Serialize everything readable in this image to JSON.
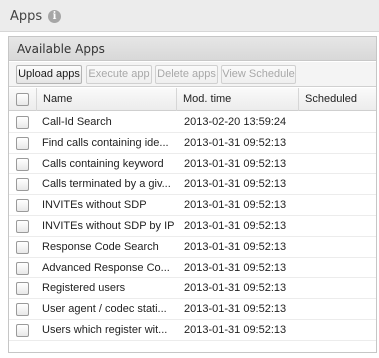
{
  "header": {
    "title": "Apps",
    "info_icon": "i"
  },
  "panel": {
    "title": "Available Apps"
  },
  "toolbar": {
    "upload": "Upload apps",
    "execute": "Execute app",
    "delete": "Delete apps",
    "schedule": "View Schedule"
  },
  "columns": {
    "name": "Name",
    "mod_time": "Mod. time",
    "scheduled": "Scheduled"
  },
  "rows": [
    {
      "name": "Call-Id Search",
      "mod_time": "2013-02-20 13:59:24",
      "scheduled": ""
    },
    {
      "name": "Find calls containing ide...",
      "mod_time": "2013-01-31 09:52:13",
      "scheduled": ""
    },
    {
      "name": "Calls containing keyword",
      "mod_time": "2013-01-31 09:52:13",
      "scheduled": ""
    },
    {
      "name": "Calls terminated by a giv...",
      "mod_time": "2013-01-31 09:52:13",
      "scheduled": ""
    },
    {
      "name": "INVITEs without SDP",
      "mod_time": "2013-01-31 09:52:13",
      "scheduled": ""
    },
    {
      "name": "INVITEs without SDP by IP",
      "mod_time": "2013-01-31 09:52:13",
      "scheduled": ""
    },
    {
      "name": "Response Code Search",
      "mod_time": "2013-01-31 09:52:13",
      "scheduled": ""
    },
    {
      "name": "Advanced Response Co...",
      "mod_time": "2013-01-31 09:52:13",
      "scheduled": ""
    },
    {
      "name": "Registered users",
      "mod_time": "2013-01-31 09:52:13",
      "scheduled": ""
    },
    {
      "name": "User agent / codec stati...",
      "mod_time": "2013-01-31 09:52:13",
      "scheduled": ""
    },
    {
      "name": "Users which register wit...",
      "mod_time": "2013-01-31 09:52:13",
      "scheduled": ""
    }
  ]
}
